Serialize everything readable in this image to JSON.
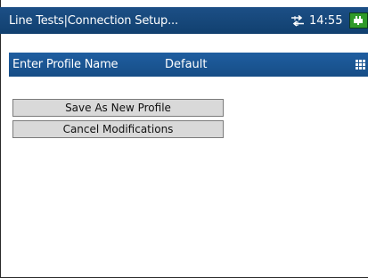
{
  "titlebar": {
    "title": "Line Tests|Connection Setup...",
    "time": "14:55",
    "network_icon": "network-transfer-icon",
    "battery_icon": "battery-charging-icon"
  },
  "profile": {
    "label": "Enter Profile Name",
    "value": "Default",
    "keypad_icon": "keypad-grid-icon"
  },
  "actions": {
    "save_new": "Save As New Profile",
    "cancel": "Cancel Modifications"
  },
  "colors": {
    "titlebar": "#11406f",
    "profile_bar": "#1f5ea0",
    "button_bg": "#d9d9d9",
    "battery": "#2f9a2a"
  }
}
